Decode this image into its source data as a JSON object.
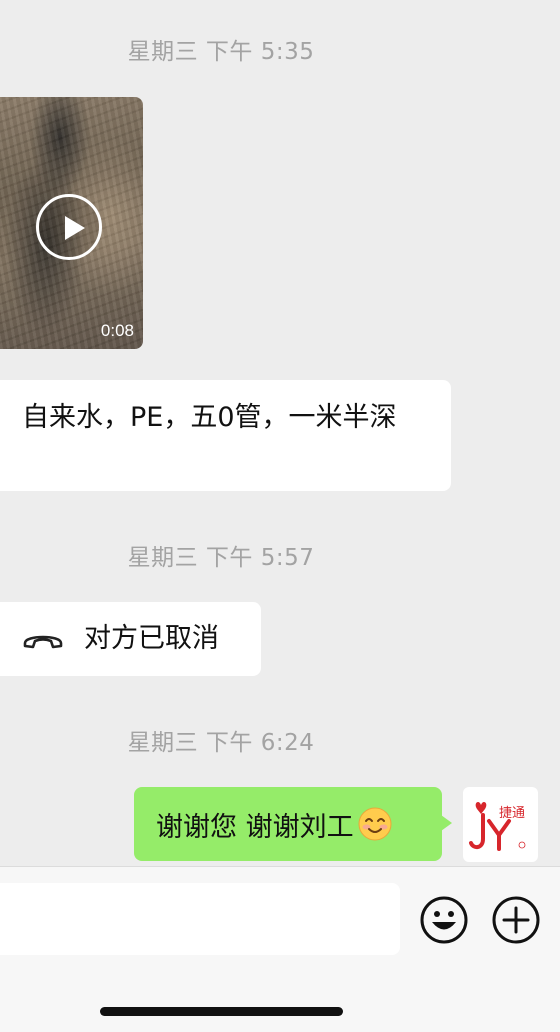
{
  "chat": {
    "timestamps": [
      "星期三 下午 5:35",
      "星期三 下午 5:57",
      "星期三 下午 6:24"
    ],
    "video_message": {
      "duration": "0:08"
    },
    "text_message": {
      "text": "自来水，PE，五0管，一米半深"
    },
    "call_message": {
      "label": "对方已取消",
      "icon": "phone-hangup-icon"
    },
    "sent_message": {
      "text": "谢谢您 谢谢刘工",
      "emoji": "smile-emoji"
    },
    "avatar": {
      "text": "捷通",
      "accent": "#d7262c"
    }
  },
  "input_bar": {
    "placeholder": "",
    "emoji_button_icon": "emoji-face-icon",
    "more_button_icon": "plus-circle-icon"
  },
  "colors": {
    "background": "#ededed",
    "sent_bubble": "#95ec69",
    "received_bubble": "#ffffff",
    "timestamp_text": "#a3a3a3"
  }
}
